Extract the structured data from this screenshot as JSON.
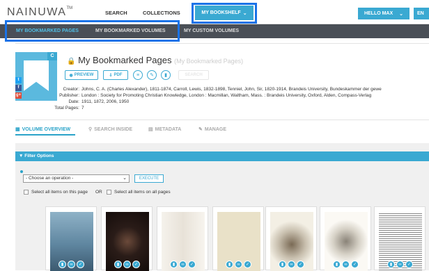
{
  "header": {
    "logo": "NAINUWA",
    "logo_mark": "TM",
    "nav": [
      "SEARCH",
      "COLLECTIONS"
    ],
    "my_bookshelf": "MY BOOKSHELF",
    "user_button": "HELLO MAX",
    "lang_button": "EN"
  },
  "subnav": {
    "tabs": [
      "MY BOOKMARKED PAGES",
      "MY BOOKMARKED VOLUMES",
      "MY CUSTOM VOLUMES"
    ]
  },
  "item": {
    "title": "My Bookmarked Pages",
    "subtitle": "(My Bookmarked Pages)",
    "cover_badge": "C",
    "social": [
      "t",
      "f",
      "g+"
    ],
    "actions": {
      "preview": "PREVIEW",
      "pdf": "PDF",
      "disabled": "SEARCH"
    },
    "meta": [
      {
        "key": "Creator:",
        "value": "Johns, C. A. (Charles Alexander), 1811-1874, Carroll, Lewis, 1832-1898, Tenniel, John, Sir, 1820-1914, Brandeis University, Bundeskammer der gewe"
      },
      {
        "key": "Publisher:",
        "value": "London : Society for Promoting Christian Knowledge, London : Macmillan, Waltham, Mass. : Brandeis University, Oxford, Alden, Compass-Verlag"
      },
      {
        "key": "Date:",
        "value": "1911, 1872, 2006, 1950"
      },
      {
        "key": "Total Pages:",
        "value": "7"
      }
    ]
  },
  "volume_tabs": [
    "VOLUME OVERVIEW",
    "SEARCH INSIDE",
    "METADATA",
    "MANAGE"
  ],
  "filter": {
    "title": "Filter Options",
    "select_value": "- Choose an operation -",
    "execute": "EXECUTE",
    "select_page": "Select all items on this page",
    "or": "OR",
    "select_all": "Select all items on all pages"
  },
  "colors": {
    "accent": "#3aa9d2",
    "subbar": "#4a4f57",
    "highlight": "#1a73e8"
  }
}
